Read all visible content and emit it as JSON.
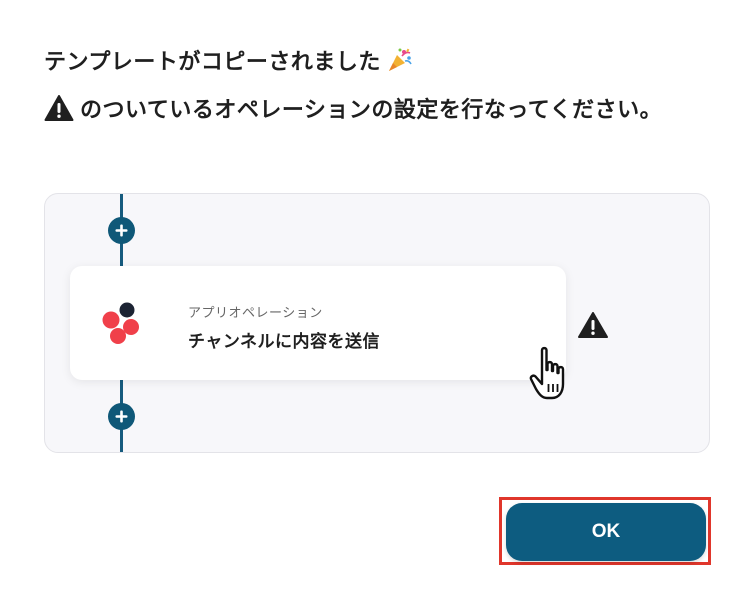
{
  "dialog": {
    "title": "テンプレートがコピーされました",
    "title_icon": "party-popper-icon",
    "subtitle": "のついているオペレーションの設定を行なってください。",
    "subtitle_icon": "warning-icon"
  },
  "flow": {
    "add_step_icon": "plus-icon",
    "operation": {
      "caption": "アプリオペレーション",
      "title": "チャンネルに内容を送信",
      "app_icon": "app-logo-icon",
      "status_icon": "warning-icon"
    }
  },
  "footer": {
    "ok_label": "OK"
  },
  "colors": {
    "primary": "#0d5c80",
    "highlight_border": "#e0362b",
    "panel_bg": "#f7f7fa",
    "logo_red": "#f0404a",
    "logo_dark": "#1c2333"
  }
}
